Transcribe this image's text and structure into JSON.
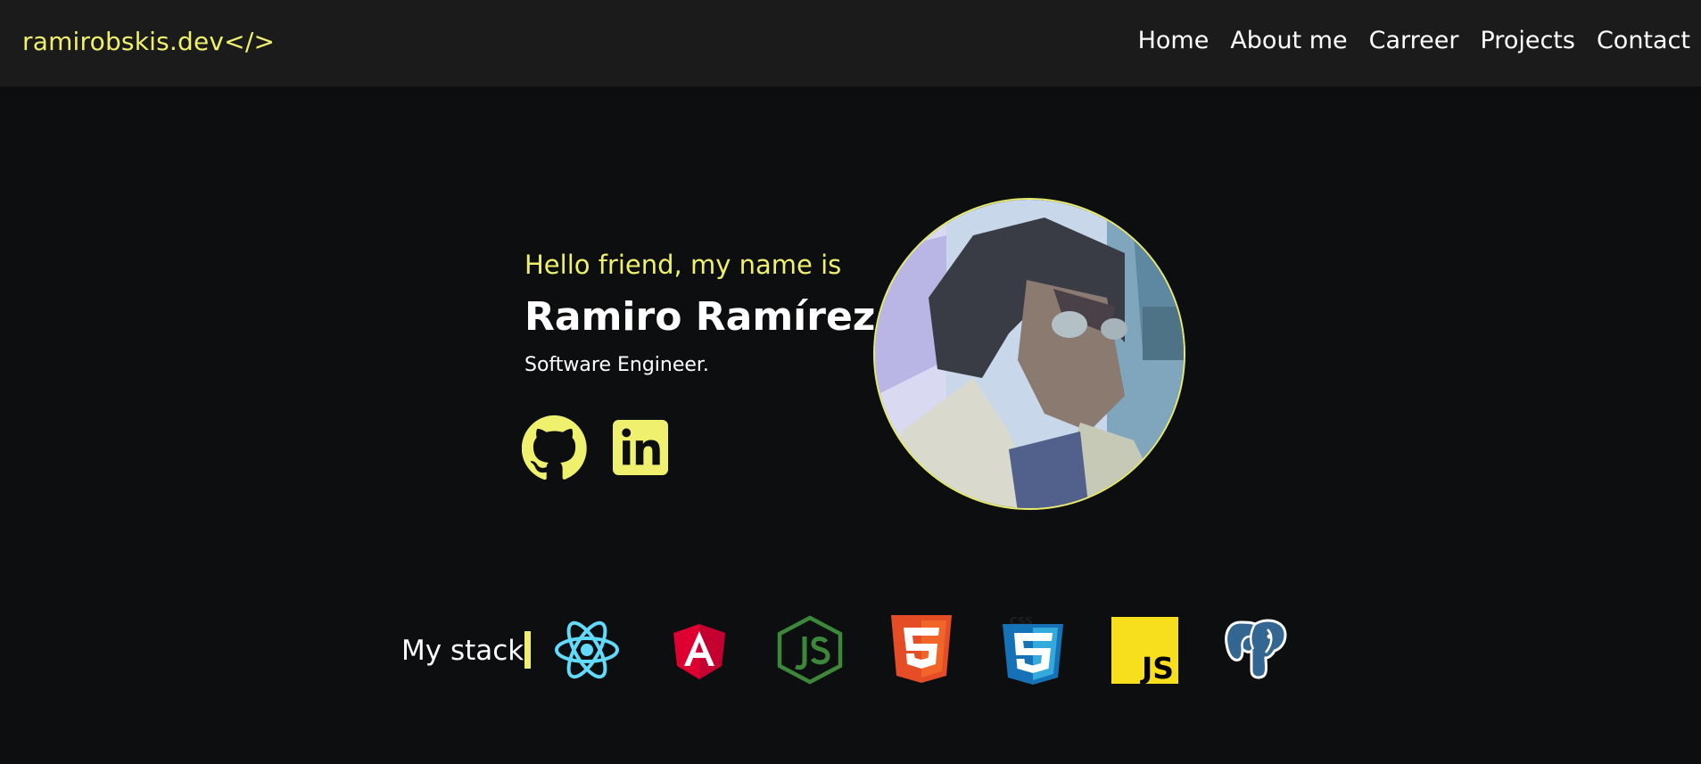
{
  "navbar": {
    "brand": "ramirobskis.dev</>",
    "links": [
      "Home",
      "About me",
      "Carreer",
      "Projects",
      "Contact"
    ]
  },
  "hero": {
    "greeting": "Hello friend, my name is",
    "name": "Ramiro Ramírez",
    "role": "Software Engineer.",
    "socials": [
      "github-icon",
      "linkedin-icon"
    ]
  },
  "stack": {
    "label": "My stack",
    "icons": [
      "react-icon",
      "angular-icon",
      "nodejs-icon",
      "html5-icon",
      "css3-icon",
      "javascript-icon",
      "postgresql-icon"
    ]
  },
  "colors": {
    "accent": "#eef06e",
    "background": "#0d0e10",
    "navbar": "#1b1b1b"
  }
}
